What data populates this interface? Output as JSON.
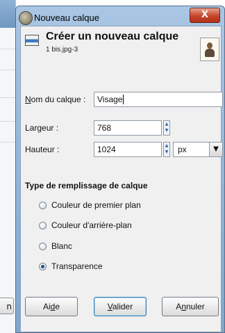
{
  "background_window": {
    "button_fragment": "n"
  },
  "dialog": {
    "title": "Nouveau calque",
    "close_glyph": "X",
    "header": {
      "title": "Créer un nouveau calque",
      "subtitle": "1 bis.jpg-3"
    },
    "fields": {
      "name_label_u": "N",
      "name_label_rest": "om du calque :",
      "name_value": "Visage",
      "width_label": "Largeur :",
      "width_value": "768",
      "height_label": "Hauteur :",
      "height_value": "1024",
      "unit_value": "px"
    },
    "fill": {
      "section_title": "Type de remplissage de calque",
      "options": [
        {
          "label": "Couleur de premier plan",
          "selected": false
        },
        {
          "label": "Couleur d'arrière-plan",
          "selected": false
        },
        {
          "label": "Blanc",
          "selected": false
        },
        {
          "label": "Transparence",
          "selected": true
        }
      ]
    },
    "buttons": {
      "help_pre": "Ai",
      "help_u": "d",
      "help_post": "e",
      "ok_u": "V",
      "ok_rest": "alider",
      "cancel_pre": "A",
      "cancel_u": "n",
      "cancel_post": "nuler"
    }
  },
  "icons": {
    "app": "gimp-wilber-icon",
    "header": "new-layer-icon",
    "thumbnail": "image-thumbnail-icon",
    "spin_up": "▲",
    "spin_down": "▼",
    "dropdown": "▼"
  }
}
